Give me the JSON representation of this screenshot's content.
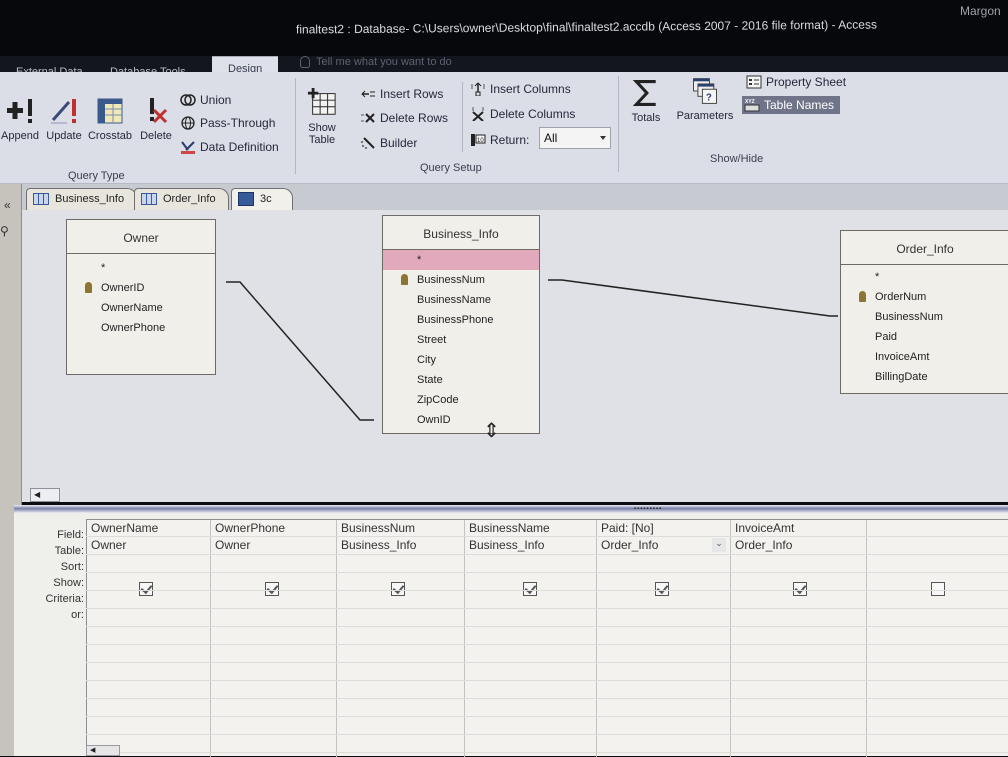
{
  "window": {
    "title": "finaltest2 : Database- C:\\Users\\owner\\Desktop\\final\\finaltest2.accdb (Access 2007 - 2016 file format)  -  Access",
    "user": "Margon",
    "tell_me_placeholder": "Tell me what you want to do"
  },
  "ribbon_tabs": [
    {
      "label": "External Data",
      "active": false
    },
    {
      "label": "Database Tools",
      "active": false
    },
    {
      "label": "Design",
      "active": true
    }
  ],
  "ribbon": {
    "query_type": {
      "label": "Query Type",
      "buttons": [
        {
          "label": "Append",
          "icon": "append-query-icon"
        },
        {
          "label": "Update",
          "icon": "update-query-icon"
        },
        {
          "label": "Crosstab",
          "icon": "crosstab-query-icon"
        },
        {
          "label": "Delete",
          "icon": "delete-query-icon"
        }
      ],
      "small_buttons": [
        {
          "label": "Union",
          "icon": "union-icon"
        },
        {
          "label": "Pass-Through",
          "icon": "globe-icon"
        },
        {
          "label": "Data Definition",
          "icon": "data-definition-icon"
        }
      ]
    },
    "query_setup": {
      "label": "Query Setup",
      "show_table": "Show\nTable",
      "show_table_line1": "Show",
      "show_table_line2": "Table",
      "small_buttons": [
        {
          "label": "Insert Rows",
          "icon": "insert-rows-icon"
        },
        {
          "label": "Delete Rows",
          "icon": "delete-rows-icon"
        },
        {
          "label": "Builder",
          "icon": "builder-wand-icon"
        },
        {
          "label": "Insert Columns",
          "icon": "insert-columns-icon"
        },
        {
          "label": "Delete Columns",
          "icon": "delete-columns-icon"
        }
      ],
      "return_label": "Return:",
      "return_value": "All"
    },
    "show_hide": {
      "label": "Show/Hide",
      "totals": "Totals",
      "parameters": "Parameters",
      "property_sheet": "Property Sheet",
      "table_names": "Table Names"
    }
  },
  "document_tabs": [
    {
      "label": "Business_Info",
      "type": "table",
      "active": false
    },
    {
      "label": "Order_Info",
      "type": "table",
      "active": false
    },
    {
      "label": "3c",
      "type": "query",
      "active": true
    }
  ],
  "nav_pane": {
    "collapse_glyph": "«",
    "search_glyph": "⚲"
  },
  "field_lists": [
    {
      "title": "Owner",
      "fields": [
        "*",
        "OwnerID",
        "OwnerName",
        "OwnerPhone"
      ],
      "key_field": "OwnerID"
    },
    {
      "title": "Business_Info",
      "fields": [
        "*",
        "BusinessNum",
        "BusinessName",
        "BusinessPhone",
        "Street",
        "City",
        "State",
        "ZipCode",
        "OwnID"
      ],
      "key_field": "BusinessNum",
      "selected_field": "*"
    },
    {
      "title": "Order_Info",
      "fields": [
        "*",
        "OrderNum",
        "BusinessNum",
        "Paid",
        "InvoiceAmt",
        "BillingDate"
      ],
      "key_field": "OrderNum"
    }
  ],
  "relationships": [
    {
      "from": "Owner.OwnerID",
      "to": "Business_Info.OwnID"
    },
    {
      "from": "Business_Info.BusinessNum",
      "to": "Order_Info.BusinessNum"
    }
  ],
  "qbe_grid": {
    "row_labels": [
      "Field:",
      "Table:",
      "Sort:",
      "Show:",
      "Criteria:",
      "or:"
    ],
    "columns": [
      {
        "field": "OwnerName",
        "table": "Owner",
        "sort": "",
        "show": true,
        "criteria": "",
        "or": ""
      },
      {
        "field": "OwnerPhone",
        "table": "Owner",
        "sort": "",
        "show": true,
        "criteria": "",
        "or": ""
      },
      {
        "field": "BusinessNum",
        "table": "Business_Info",
        "sort": "",
        "show": true,
        "criteria": "",
        "or": ""
      },
      {
        "field": "BusinessName",
        "table": "Business_Info",
        "sort": "",
        "show": true,
        "criteria": "",
        "or": ""
      },
      {
        "field": "Paid: [No]",
        "table": "Order_Info",
        "sort": "",
        "show": true,
        "criteria": "",
        "or": "",
        "has_dropdown": true
      },
      {
        "field": "InvoiceAmt",
        "table": "Order_Info",
        "sort": "",
        "show": true,
        "criteria": "",
        "or": ""
      },
      {
        "field": "",
        "table": "",
        "sort": "",
        "show": false,
        "criteria": "",
        "or": ""
      }
    ]
  }
}
